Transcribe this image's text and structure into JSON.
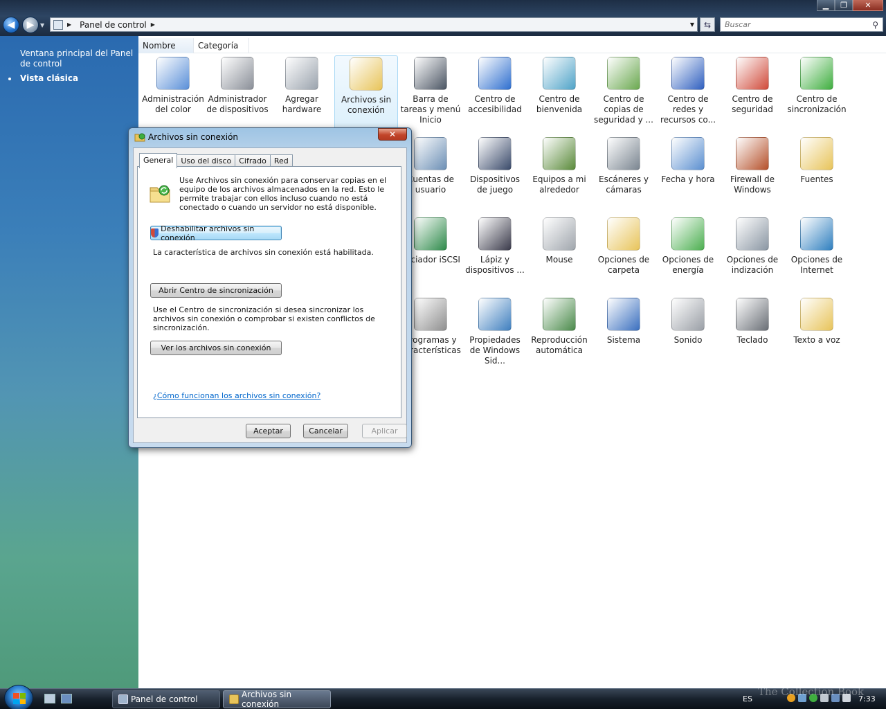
{
  "window": {
    "address_crumb": "Panel de control",
    "search_placeholder": "Buscar",
    "minimize": "▁",
    "maximize": "❐",
    "close": "✕"
  },
  "sidebar": {
    "items": [
      {
        "label": "Ventana principal del Panel de control"
      },
      {
        "label": "Vista clásica"
      }
    ]
  },
  "columns": {
    "name": "Nombre",
    "category": "Categoría"
  },
  "icons": [
    {
      "label": "Administración del color",
      "icon": "color-management-icon",
      "color": "#5a8fd8"
    },
    {
      "label": "Administrador de dispositivos",
      "icon": "device-manager-icon",
      "color": "#8a8f98"
    },
    {
      "label": "Agregar hardware",
      "icon": "add-hardware-icon",
      "color": "#9aa3ad"
    },
    {
      "label": "Archivos sin conexión",
      "icon": "offline-files-icon",
      "color": "#e8c45a"
    },
    {
      "label": "Barra de tareas y menú Inicio",
      "icon": "taskbar-icon",
      "color": "#4b5563"
    },
    {
      "label": "Centro de accesibilidad",
      "icon": "accessibility-icon",
      "color": "#2f6fcf"
    },
    {
      "label": "Centro de bienvenida",
      "icon": "welcome-center-icon",
      "color": "#4fa3c8"
    },
    {
      "label": "Centro de copias de seguridad y ...",
      "icon": "backup-icon",
      "color": "#6aa84f"
    },
    {
      "label": "Centro de redes y recursos co...",
      "icon": "network-center-icon",
      "color": "#2f5fbf"
    },
    {
      "label": "Centro de seguridad",
      "icon": "security-shield-icon",
      "color": "#d04a3a"
    },
    {
      "label": "Centro de sincronización",
      "icon": "sync-center-icon",
      "color": "#3fae3f"
    },
    {
      "label": "Cuentas de usuario",
      "icon": "user-accounts-icon",
      "color": "#6c8fb5"
    },
    {
      "label": "Dispositivos de juego",
      "icon": "game-controller-icon",
      "color": "#3a4a6a"
    },
    {
      "label": "Equipos a mi alrededor",
      "icon": "people-near-me-icon",
      "color": "#5a8a3a"
    },
    {
      "label": "Escáneres y cámaras",
      "icon": "scanner-icon",
      "color": "#7a8590"
    },
    {
      "label": "Fecha y hora",
      "icon": "date-time-icon",
      "color": "#5b8fd0"
    },
    {
      "label": "Firewall de Windows",
      "icon": "firewall-icon",
      "color": "#b5502a"
    },
    {
      "label": "Fuentes",
      "icon": "fonts-icon",
      "color": "#e8c45a"
    },
    {
      "label": "Iniciador iSCSI",
      "icon": "iscsi-icon",
      "color": "#2e8a4a"
    },
    {
      "label": "Lápiz y dispositivos ...",
      "icon": "pen-icon",
      "color": "#3a3a4a"
    },
    {
      "label": "Mouse",
      "icon": "mouse-icon",
      "color": "#a0a6ad"
    },
    {
      "label": "Opciones de carpeta",
      "icon": "folder-options-icon",
      "color": "#e8c45a"
    },
    {
      "label": "Opciones de energía",
      "icon": "power-options-icon",
      "color": "#4caf50"
    },
    {
      "label": "Opciones de indización",
      "icon": "indexing-icon",
      "color": "#8a96a3"
    },
    {
      "label": "Opciones de Internet",
      "icon": "internet-options-icon",
      "color": "#2f7fbf"
    },
    {
      "label": "Programas y características",
      "icon": "programs-icon",
      "color": "#8f8f8f"
    },
    {
      "label": "Propiedades de Windows Sid...",
      "icon": "sidebar-properties-icon",
      "color": "#3f7fbf"
    },
    {
      "label": "Reproducción automática",
      "icon": "autoplay-icon",
      "color": "#4a8a4a"
    },
    {
      "label": "Sistema",
      "icon": "system-icon",
      "color": "#3a6fbf"
    },
    {
      "label": "Sonido",
      "icon": "speaker-icon",
      "color": "#9a9fa6"
    },
    {
      "label": "Teclado",
      "icon": "keyboard-icon",
      "color": "#6a6f76"
    },
    {
      "label": "Texto a voz",
      "icon": "text-to-speech-icon",
      "color": "#e8c45a"
    }
  ],
  "dialog": {
    "title": "Archivos sin conexión",
    "close": "✕",
    "tabs": [
      "General",
      "Uso del disco",
      "Cifrado",
      "Red"
    ],
    "description": "Use Archivos sin conexión para conservar copias en el equipo de los archivos almacenados en la red. Esto le permite trabajar con ellos incluso cuando no está conectado o cuando un servidor no está disponible.",
    "disable_button": "Deshabilitar archivos sin conexión",
    "status_text": "La característica de archivos sin conexión está habilitada.",
    "sync_button": "Abrir Centro de sincronización",
    "sync_text": "Use el Centro de sincronización si desea sincronizar los archivos sin conexión o comprobar si existen conflictos de sincronización.",
    "view_button": "Ver los archivos sin conexión",
    "help_link": "¿Cómo funcionan los archivos sin conexión?",
    "ok": "Aceptar",
    "cancel": "Cancelar",
    "apply": "Aplicar"
  },
  "taskbar": {
    "buttons": [
      {
        "label": "Panel de control"
      },
      {
        "label": "Archivos sin conexión"
      }
    ],
    "language": "ES",
    "time": "7:33",
    "watermark": "The Collection Book"
  }
}
